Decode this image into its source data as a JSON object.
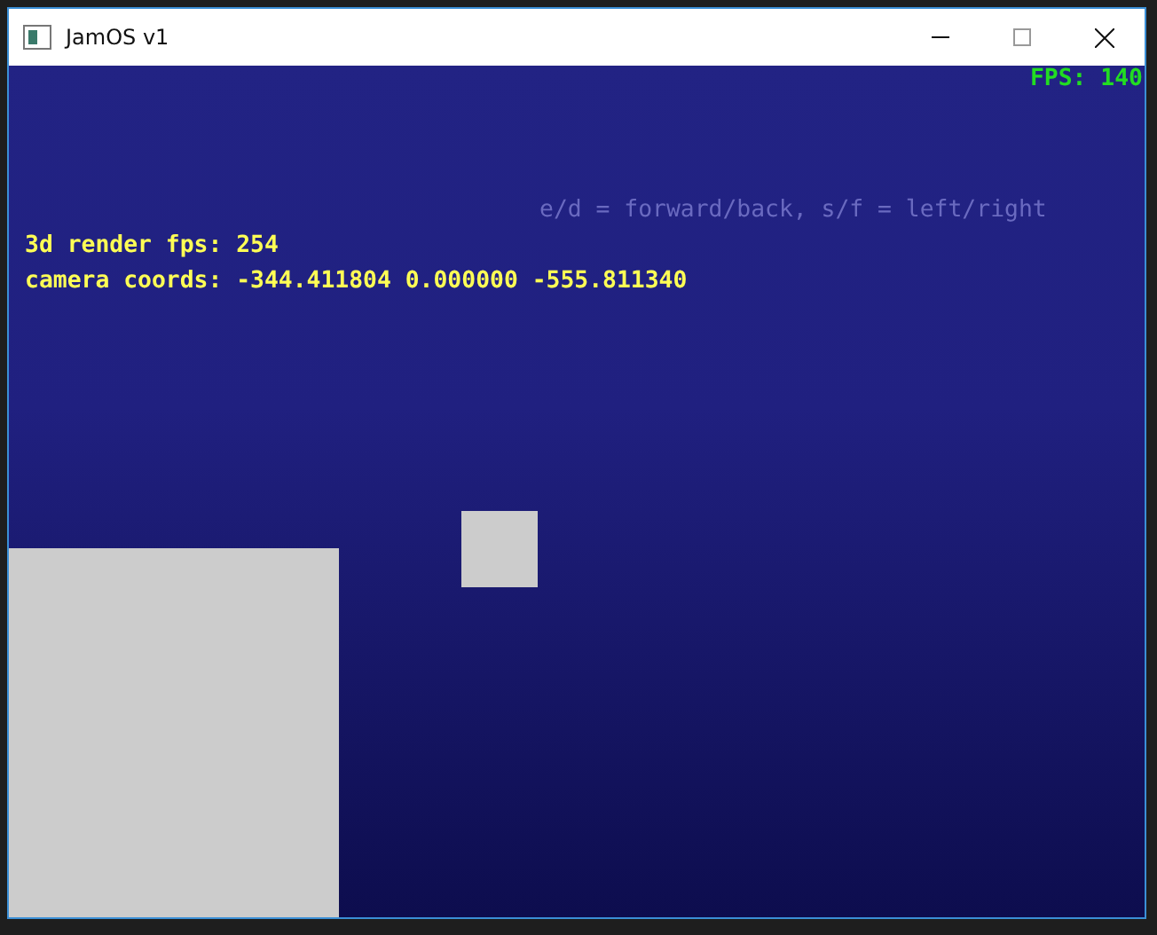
{
  "window": {
    "title": "JamOS v1"
  },
  "overlay": {
    "fps": "FPS: 140",
    "hint": "e/d = forward/back, s/f = left/right",
    "render_fps": "3d render fps: 254",
    "camera": "camera coords: -344.411804 0.000000 -555.811340"
  }
}
